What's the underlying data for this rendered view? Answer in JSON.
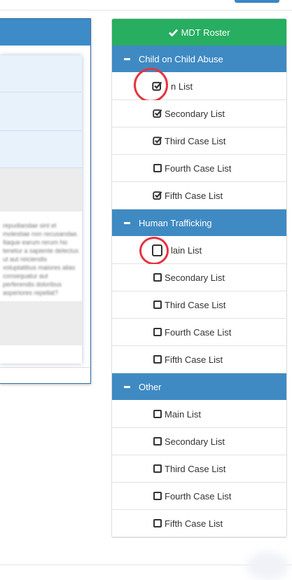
{
  "roster": {
    "label": "MDT Roster",
    "icon": "check-icon",
    "color": "#27ae60"
  },
  "sections": [
    {
      "title": "Child on Child Abuse",
      "items": [
        {
          "label": "Main List",
          "visible_label": "n List",
          "checked": true,
          "highlighted": true
        },
        {
          "label": "Secondary List",
          "checked": true
        },
        {
          "label": "Third Case List",
          "checked": true
        },
        {
          "label": "Fourth Case List",
          "checked": false
        },
        {
          "label": "Fifth Case List",
          "checked": true
        }
      ]
    },
    {
      "title": "Human Trafficking",
      "items": [
        {
          "label": "Main List",
          "visible_label": "lain List",
          "checked": false,
          "highlighted": true
        },
        {
          "label": "Secondary List",
          "checked": false
        },
        {
          "label": "Third Case List",
          "checked": false
        },
        {
          "label": "Fourth Case List",
          "checked": false
        },
        {
          "label": "Fifth Case List",
          "checked": false
        }
      ]
    },
    {
      "title": "Other",
      "items": [
        {
          "label": "Main List",
          "checked": false
        },
        {
          "label": "Secondary List",
          "checked": false
        },
        {
          "label": "Third Case List",
          "checked": false
        },
        {
          "label": "Fourth Case List",
          "checked": false
        },
        {
          "label": "Fifth Case List",
          "checked": false
        }
      ]
    }
  ],
  "colors": {
    "section_header": "#3f8ac2",
    "highlight_ring": "#e5333f",
    "primary": "#3a86c4"
  },
  "left_panel": {
    "blurred_text": "repudiandae sint et molestiae non recusandae. Itaque earum rerum hic tenetur a sapiente delectus ut aut reiciendis voluptatibus maiores alias consequatur aut perferendis doloribus asperiores repellat?"
  }
}
